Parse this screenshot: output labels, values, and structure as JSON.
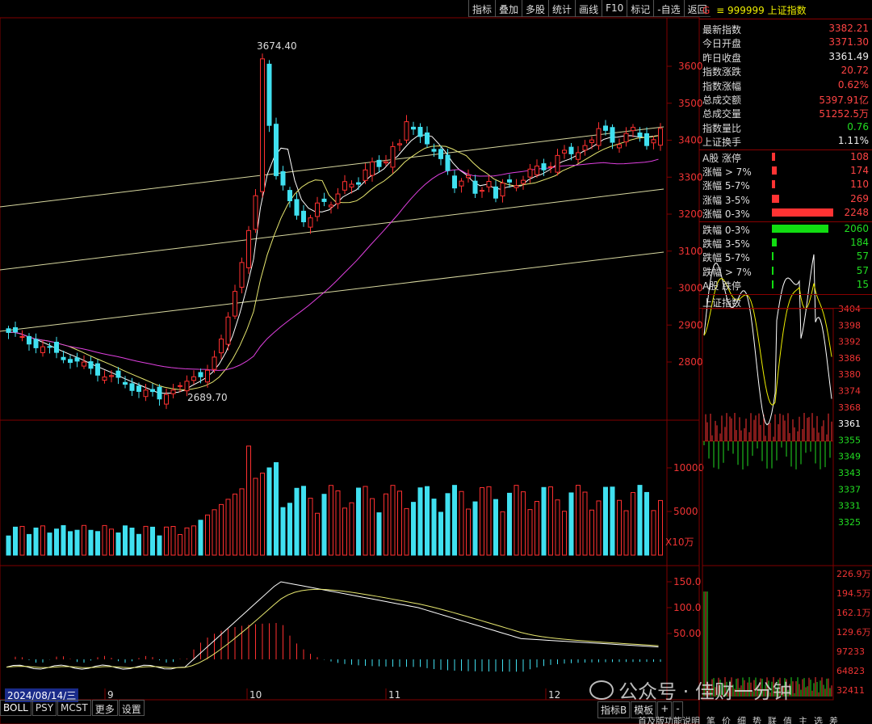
{
  "toolbar": [
    "指标",
    "叠加",
    "多股",
    "统计",
    "画线",
    "F10",
    "标记",
    "-自选",
    "返回"
  ],
  "stock": {
    "g": "G",
    "code": "≡ 999999",
    "name": "上证指数"
  },
  "quote": [
    {
      "label": "最新指数",
      "value": "3382.21",
      "color": "red"
    },
    {
      "label": "今日开盘",
      "value": "3371.30",
      "color": "red"
    },
    {
      "label": "昨日收盘",
      "value": "3361.49",
      "color": "wht"
    },
    {
      "label": "指数涨跌",
      "value": "20.72",
      "color": "red"
    },
    {
      "label": "指数涨幅",
      "value": "0.62%",
      "color": "red"
    },
    {
      "label": "总成交额",
      "value": "5397.91亿",
      "color": "red"
    },
    {
      "label": "总成交量",
      "value": "51252.5万",
      "color": "red"
    },
    {
      "label": "指数量比",
      "value": "0.76",
      "color": "grn"
    },
    {
      "label": "上证换手",
      "value": "1.11%",
      "color": "wht"
    }
  ],
  "breadth_up": [
    {
      "label": "A股 涨停",
      "value": "108"
    },
    {
      "label": "涨幅 > 7%",
      "value": "174"
    },
    {
      "label": "涨幅 5-7%",
      "value": "110"
    },
    {
      "label": "涨幅 3-5%",
      "value": "269"
    },
    {
      "label": "涨幅 0-3%",
      "value": "2248"
    }
  ],
  "breadth_down": [
    {
      "label": "跌幅 0-3%",
      "value": "2060"
    },
    {
      "label": "跌幅 3-5%",
      "value": "184"
    },
    {
      "label": "跌幅 5-7%",
      "value": "57"
    },
    {
      "label": "跌幅 > 7%",
      "value": "57"
    },
    {
      "label": "A股 跌停",
      "value": "15"
    }
  ],
  "mini_title": "上证指数",
  "mini_price_ticks": [
    "3404",
    "3398",
    "3392",
    "3386",
    "3380",
    "3374",
    "3368",
    "3361",
    "3355",
    "3349",
    "3343",
    "3337",
    "3331",
    "3325"
  ],
  "mini_vol_ticks": [
    "226.9万",
    "194.5万",
    "162.1万",
    "129.6万",
    "97233",
    "64823",
    "32411"
  ],
  "price_axis": [
    "3600",
    "3500",
    "3400",
    "3300",
    "3200",
    "3100",
    "3000",
    "2900",
    "2800"
  ],
  "vol_axis": [
    "10000",
    "5000"
  ],
  "vol_unit": "X10万",
  "macd_axis": [
    "150.0",
    "100.0",
    "50.00"
  ],
  "high_label": "3674.40",
  "low_label": "2689.70",
  "months": [
    "9",
    "10",
    "11",
    "12"
  ],
  "date_label": "2024/08/14/三",
  "bottom_tabs": [
    "BOLL",
    "PSY",
    "MCST",
    "更多",
    "设置"
  ],
  "right_tabs": [
    "指标B",
    "模板",
    "+",
    "-"
  ],
  "bottom_right": [
    "首及版功能说明",
    "笔",
    "价",
    "细",
    "势",
    "联",
    "值",
    "主",
    "选",
    "差"
  ],
  "watermark": "公众号 · 佳财一分钟",
  "colors": {
    "up": "#ff3030",
    "down": "#40e0f0",
    "ma1": "#ffffff",
    "ma2": "#e8e870",
    "ma3": "#e040e0",
    "grid": "#800000"
  }
}
